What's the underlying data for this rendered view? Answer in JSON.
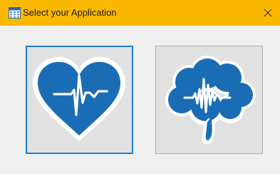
{
  "window": {
    "title": "Select your Application",
    "icon": "grid-app-icon",
    "close_glyph": "✕"
  },
  "options": [
    {
      "name": "heart",
      "icon": "heart-ecg-icon",
      "selected": true
    },
    {
      "name": "brain",
      "icon": "brain-eeg-icon",
      "selected": false
    }
  ],
  "colors": {
    "titlebar": "#fbb800",
    "icon_blue": "#1a6db5",
    "focus_border": "#1e7fd4",
    "tile_bg": "#e1e1e1"
  }
}
